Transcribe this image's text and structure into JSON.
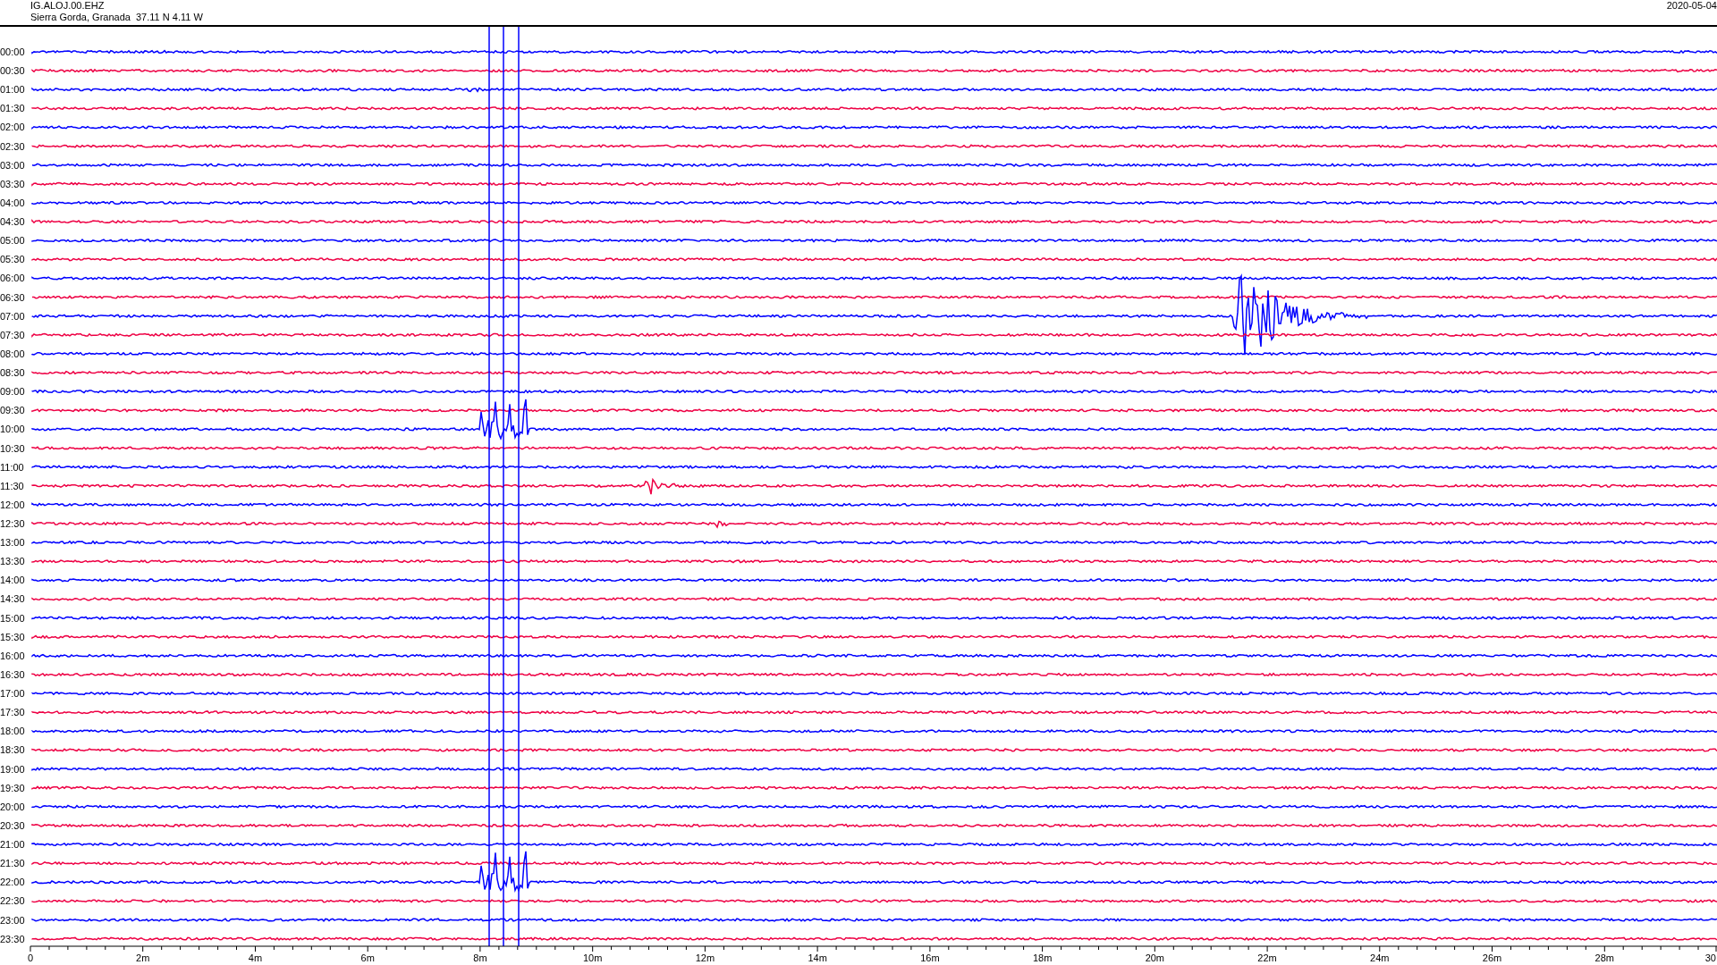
{
  "header": {
    "station": "IG.ALOJ.00.EHZ",
    "location": "Sierra Gorda, Granada  37.11 N 4.11 W",
    "date": "2020-05-04"
  },
  "rows": [
    {
      "time": "00:00",
      "color": "#0000ff"
    },
    {
      "time": "00:30",
      "color": "#ee0044"
    },
    {
      "time": "01:00",
      "color": "#0000ff"
    },
    {
      "time": "01:30",
      "color": "#ee0044"
    },
    {
      "time": "02:00",
      "color": "#0000ff"
    },
    {
      "time": "02:30",
      "color": "#ee0044"
    },
    {
      "time": "03:00",
      "color": "#0000ff"
    },
    {
      "time": "03:30",
      "color": "#ee0044"
    },
    {
      "time": "04:00",
      "color": "#0000ff"
    },
    {
      "time": "04:30",
      "color": "#ee0044"
    },
    {
      "time": "05:00",
      "color": "#0000ff"
    },
    {
      "time": "05:30",
      "color": "#ee0044"
    },
    {
      "time": "06:00",
      "color": "#0000ff"
    },
    {
      "time": "06:30",
      "color": "#ee0044"
    },
    {
      "time": "07:00",
      "color": "#0000ff"
    },
    {
      "time": "07:30",
      "color": "#ee0044"
    },
    {
      "time": "08:00",
      "color": "#0000ff"
    },
    {
      "time": "08:30",
      "color": "#ee0044"
    },
    {
      "time": "09:00",
      "color": "#0000ff"
    },
    {
      "time": "09:30",
      "color": "#ee0044"
    },
    {
      "time": "10:00",
      "color": "#0000ff"
    },
    {
      "time": "10:30",
      "color": "#ee0044"
    },
    {
      "time": "11:00",
      "color": "#0000ff"
    },
    {
      "time": "11:30",
      "color": "#ee0044"
    },
    {
      "time": "12:00",
      "color": "#0000ff"
    },
    {
      "time": "12:30",
      "color": "#ee0044"
    },
    {
      "time": "13:00",
      "color": "#0000ff"
    },
    {
      "time": "13:30",
      "color": "#ee0044"
    },
    {
      "time": "14:00",
      "color": "#0000ff"
    },
    {
      "time": "14:30",
      "color": "#ee0044"
    },
    {
      "time": "15:00",
      "color": "#0000ff"
    },
    {
      "time": "15:30",
      "color": "#ee0044"
    },
    {
      "time": "16:00",
      "color": "#0000ff"
    },
    {
      "time": "16:30",
      "color": "#ee0044"
    },
    {
      "time": "17:00",
      "color": "#0000ff"
    },
    {
      "time": "17:30",
      "color": "#ee0044"
    },
    {
      "time": "18:00",
      "color": "#0000ff"
    },
    {
      "time": "18:30",
      "color": "#ee0044"
    },
    {
      "time": "19:00",
      "color": "#0000ff"
    },
    {
      "time": "19:30",
      "color": "#ee0044"
    },
    {
      "time": "20:00",
      "color": "#0000ff"
    },
    {
      "time": "20:30",
      "color": "#ee0044"
    },
    {
      "time": "21:00",
      "color": "#0000ff"
    },
    {
      "time": "21:30",
      "color": "#ee0044"
    },
    {
      "time": "22:00",
      "color": "#0000ff"
    },
    {
      "time": "22:30",
      "color": "#ee0044"
    },
    {
      "time": "23:00",
      "color": "#0000ff"
    },
    {
      "time": "23:30",
      "color": "#ee0044"
    }
  ],
  "x_axis": {
    "ticks": [
      "0",
      "2m",
      "4m",
      "6m",
      "8m",
      "10m",
      "12m",
      "14m",
      "16m",
      "18m",
      "20m",
      "22m",
      "24m",
      "26m",
      "28m",
      "30"
    ]
  }
}
